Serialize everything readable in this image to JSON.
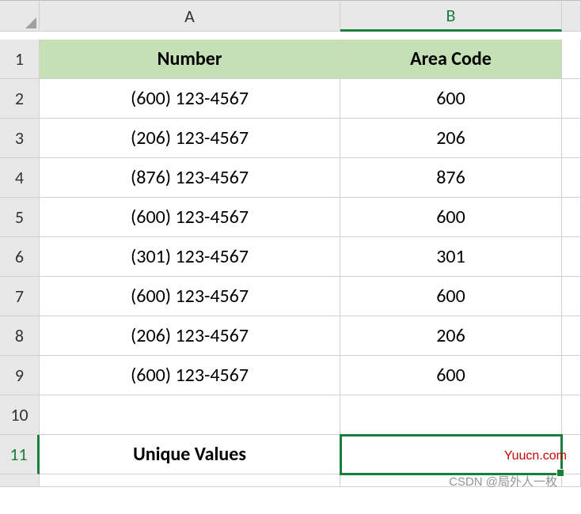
{
  "columns": {
    "A": "A",
    "B": "B"
  },
  "row_labels": [
    "1",
    "2",
    "3",
    "4",
    "5",
    "6",
    "7",
    "8",
    "9",
    "10",
    "11"
  ],
  "headers": {
    "A": "Number",
    "B": "Area Code"
  },
  "rows": [
    {
      "number": "(600) 123-4567",
      "code": "600"
    },
    {
      "number": "(206) 123-4567",
      "code": "206"
    },
    {
      "number": "(876) 123-4567",
      "code": "876"
    },
    {
      "number": "(600) 123-4567",
      "code": "600"
    },
    {
      "number": "(301) 123-4567",
      "code": "301"
    },
    {
      "number": "(600) 123-4567",
      "code": "600"
    },
    {
      "number": "(206) 123-4567",
      "code": "206"
    },
    {
      "number": "(600) 123-4567",
      "code": "600"
    }
  ],
  "row11": {
    "A": "Unique Values",
    "B": ""
  },
  "selected_cell": "B11",
  "watermarks": {
    "w1": "Yuucn.com",
    "w2": "CSDN @局外人一枚"
  },
  "chart_data": {
    "type": "table",
    "title": "",
    "columns": [
      "Number",
      "Area Code"
    ],
    "rows": [
      [
        "(600) 123-4567",
        600
      ],
      [
        "(206) 123-4567",
        206
      ],
      [
        "(876) 123-4567",
        876
      ],
      [
        "(600) 123-4567",
        600
      ],
      [
        "(301) 123-4567",
        301
      ],
      [
        "(600) 123-4567",
        600
      ],
      [
        "(206) 123-4567",
        206
      ],
      [
        "(600) 123-4567",
        600
      ]
    ],
    "footer": [
      "Unique Values",
      ""
    ]
  }
}
